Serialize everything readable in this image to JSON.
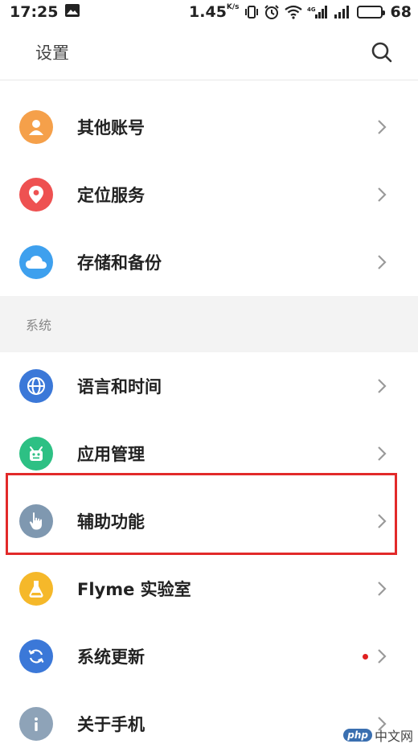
{
  "status_bar": {
    "time": "17:25",
    "speed": "1.45",
    "speed_unit": "K/s",
    "battery_level": "68",
    "battery_fraction": 0.68
  },
  "header": {
    "title": "设置",
    "search_icon": "search-icon"
  },
  "items_top": [
    {
      "label": "其他账号",
      "icon": "account-icon",
      "color": "#f5a04a"
    },
    {
      "label": "定位服务",
      "icon": "location-icon",
      "color": "#ee5151"
    },
    {
      "label": "存储和备份",
      "icon": "cloud-icon",
      "color": "#3ea0ee"
    }
  ],
  "section": {
    "label": "系统"
  },
  "items_system": [
    {
      "label": "语言和时间",
      "icon": "globe-icon",
      "color": "#3b78d8"
    },
    {
      "label": "应用管理",
      "icon": "app-manage-icon",
      "color": "#2dc084"
    },
    {
      "label": "辅助功能",
      "icon": "hand-icon",
      "color": "#7f98b0"
    },
    {
      "label": "Flyme 实验室",
      "icon": "flask-icon",
      "color": "#f5b82a"
    },
    {
      "label": "系统更新",
      "icon": "refresh-icon",
      "color": "#3b78d8",
      "badge": true
    },
    {
      "label": "关于手机",
      "icon": "info-icon",
      "color": "#8ea3b8"
    }
  ],
  "highlight_color": "#e22a2a",
  "watermark": {
    "badge": "php",
    "text": "中文网"
  }
}
